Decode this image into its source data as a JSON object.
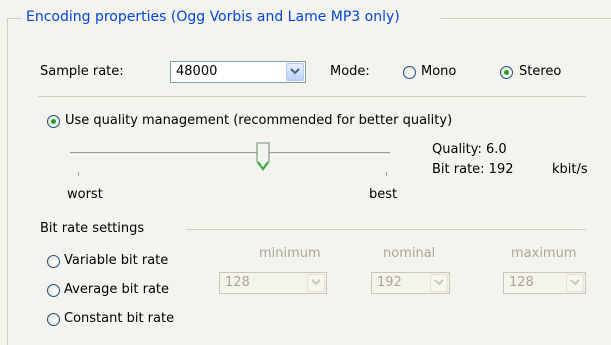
{
  "group": {
    "title": "Encoding properties (Ogg Vorbis and Lame MP3 only)"
  },
  "sample_rate": {
    "label": "Sample rate:",
    "value": "48000"
  },
  "mode": {
    "label": "Mode:",
    "options": [
      {
        "label": "Mono",
        "selected": false
      },
      {
        "label": "Stereo",
        "selected": true
      }
    ]
  },
  "quality_management": {
    "label": "Use quality management (recommended for better quality)",
    "selected": true
  },
  "quality_slider": {
    "min_label": "worst",
    "max_label": "best",
    "level_fraction": 0.6,
    "quality_text": "Quality: 6.0",
    "bitrate_text": "Bit rate: 192",
    "bitrate_unit": "kbit/s"
  },
  "bit_rate_settings": {
    "title": "Bit rate settings",
    "modes": [
      {
        "label": "Variable bit rate",
        "selected": false
      },
      {
        "label": "Average bit rate",
        "selected": false
      },
      {
        "label": "Constant bit rate",
        "selected": false
      }
    ],
    "columns": [
      {
        "label": "minimum",
        "value": "128"
      },
      {
        "label": "nominal",
        "value": "192"
      },
      {
        "label": "maximum",
        "value": "128"
      }
    ]
  },
  "icons": {
    "dropdown": "chevron-down-icon",
    "slider_thumb": "slider-thumb-icon"
  },
  "colors": {
    "group_title": "#0046d5",
    "radio_dot": "#21a121",
    "panel_bg": "#f4f3ee"
  }
}
